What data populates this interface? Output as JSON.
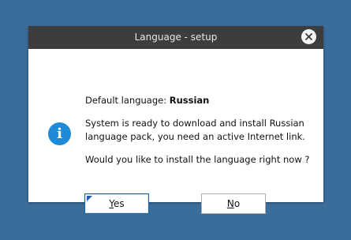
{
  "window": {
    "title": "Language - setup",
    "close_icon": "close-icon"
  },
  "message": {
    "default_label": "Default language:",
    "default_value": "Russian",
    "ready_line1": "System is ready to download and install Russian",
    "ready_line2": "language pack, you need an active Internet link.",
    "question": "Would you like to install the language right now ?",
    "icon": "info-icon"
  },
  "buttons": {
    "yes_mnemonic": "Y",
    "yes_rest": "es",
    "no_mnemonic": "N",
    "no_rest": "o"
  },
  "colors": {
    "desktop_background": "#3a6d9a",
    "titlebar": "#3d3d3d",
    "info_icon": "#1f8ad8",
    "focus_border": "#1f5f9e"
  }
}
